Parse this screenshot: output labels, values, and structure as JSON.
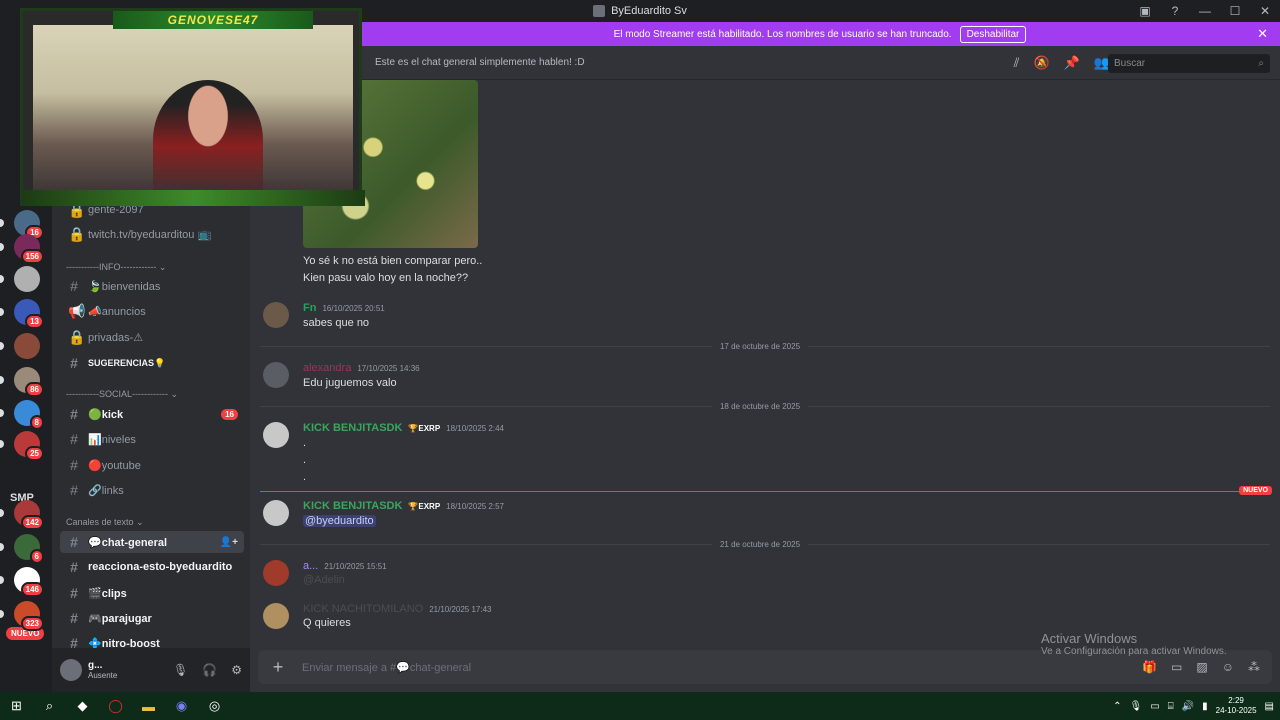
{
  "title_bar": {
    "title": "ByEduardito Sv",
    "min": "—",
    "max": "☐",
    "close": "✕"
  },
  "notice": {
    "text": "El modo Streamer está habilitado. Los nombres de usuario se han truncado.",
    "button": "Deshabilitar",
    "close": "✕"
  },
  "header": {
    "topic": "Este es el chat general simplemente hablen! :D",
    "search_placeholder": "Buscar"
  },
  "webcam": {
    "banner": "GENOVESE47"
  },
  "rail": {
    "servers": [
      {
        "badge": "16",
        "color": "#4a6a8a"
      },
      {
        "badge": "156",
        "color": "#7a2a5a"
      },
      {
        "badge": "",
        "color": "#b0b0b0"
      },
      {
        "badge": "13",
        "color": "#3a5aba"
      },
      {
        "badge": "",
        "color": "#8a4a3a"
      },
      {
        "badge": "86",
        "color": "#9a8a7a"
      },
      {
        "badge": "8",
        "color": "#3a8ada"
      },
      {
        "badge": "25",
        "color": "#ba3a3a"
      },
      {
        "badge": "142",
        "color": "#aa3a3a"
      },
      {
        "badge": "6",
        "color": "#3a6a3a"
      },
      {
        "badge": "146",
        "color": "#ffffff"
      },
      {
        "badge": "323",
        "color": "#ca4a2a"
      }
    ],
    "smp": "SMP",
    "nuevo": "NUEVO"
  },
  "sidebar": {
    "channels_top": [
      {
        "icon": "🔒",
        "label": "gente-2097"
      },
      {
        "icon": "🔒",
        "label": "twitch.tv/byeduarditou 📺"
      }
    ],
    "cat_info": "-----------INFO------------ ⌄",
    "info_channels": [
      {
        "icon": "#",
        "label": "🍃bienvenidas"
      },
      {
        "icon": "📢",
        "label": "📣anuncios"
      },
      {
        "icon": "🔒",
        "label": "privadas-⚠"
      },
      {
        "icon": "#",
        "label": "SUGERENCIAS💡"
      }
    ],
    "cat_social": "-----------SOCIAL------------ ⌄",
    "social_channels": [
      {
        "label": "🟢kick",
        "count": "16"
      },
      {
        "label": "📊niveles",
        "count": ""
      },
      {
        "label": "🔴youtube",
        "count": ""
      },
      {
        "label": "🔗links",
        "count": ""
      }
    ],
    "cat_text": "Canales de texto ⌄",
    "text_channels": [
      {
        "label": "💬chat-general",
        "extra": "👤+"
      },
      {
        "label": "reacciona-esto-byeduardito",
        "extra": ""
      },
      {
        "label": "🎬clips",
        "extra": ""
      },
      {
        "label": "🎮parajugar",
        "extra": ""
      },
      {
        "label": "💠nitro-boost",
        "extra": ""
      }
    ],
    "user": {
      "name": "g...",
      "status": "Ausente"
    }
  },
  "messages": {
    "caption1": "Yo sé k no está bien comparar pero..",
    "caption2": "Kien pasu valo hoy en la noche??",
    "m_fn": {
      "name": "Fn",
      "ts": "16/10/2025 20:51",
      "text": "sabes que no",
      "color": "#23a559"
    },
    "sep1": "17 de octubre de 2025",
    "m_alex": {
      "name": "alexandra",
      "ts": "17/10/2025 14:36",
      "text": "Edu juguemos valo",
      "color": "#a0325a"
    },
    "sep2": "18 de octubre de 2025",
    "m_kick1": {
      "name": "KICK BENJITASDK",
      "tag": "🏆EXRP",
      "ts": "18/10/2025 2:44",
      "lines": [
        ".",
        ".",
        "."
      ],
      "color": "#3ba55d"
    },
    "new_label": "NUEVO",
    "m_kick2": {
      "name": "KICK BENJITASDK",
      "tag": "🏆EXRP",
      "ts": "18/10/2025 2:57",
      "text": "@byeduardito",
      "color": "#3ba55d"
    },
    "sep3": "21 de octubre de 2025",
    "m_a": {
      "name": "a...",
      "ts": "21/10/2025 15:51",
      "text": "@Adelin",
      "color": "#a58bf5"
    },
    "m_nacho": {
      "name": "KICK NACHITOMILANO",
      "ts": "21/10/2025 17:43",
      "text": "Q quieres",
      "color": "#4a4d52"
    }
  },
  "composer": {
    "placeholder": "Enviar mensaje a #💬chat-general"
  },
  "watermark": {
    "line1": "Activar Windows",
    "line2": "Ve a Configuración para activar Windows."
  },
  "taskbar": {
    "time": "2:29",
    "date": "24-10-2025"
  }
}
